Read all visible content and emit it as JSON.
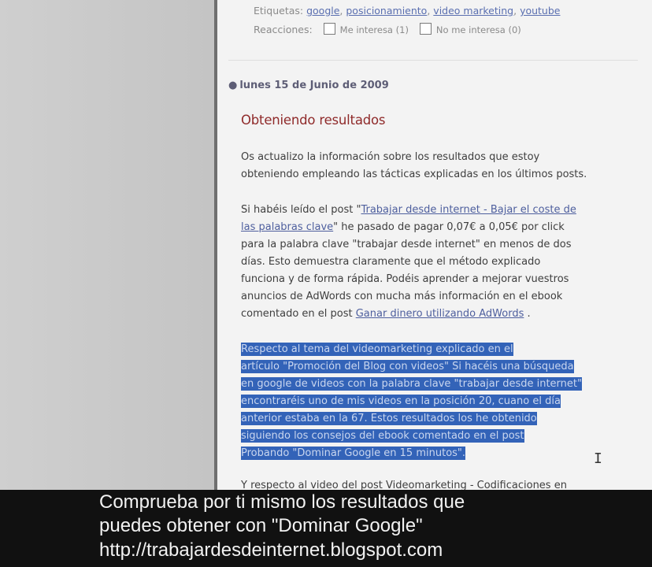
{
  "post_meta": {
    "tags_label": "Etiquetas:",
    "tags": [
      "google",
      "posicionamiento",
      "video marketing",
      "youtube"
    ],
    "reactions_label": "Reacciones:",
    "reactions": [
      {
        "label": "Me interesa (1)"
      },
      {
        "label": "No me interesa (0)"
      }
    ]
  },
  "post": {
    "date": "lunes 15 de Junio de 2009",
    "title": "Obteniendo resultados",
    "p1_lines": [
      "Os actualizo la información sobre los resultados que estoy",
      "obteniendo empleando las tácticas explicadas en los últimos posts."
    ],
    "p2": {
      "l1_pre": "Si habéis leído el post \"",
      "l1_link": "Trabajar desde internet - Bajar el coste de",
      "l2_link": "las palabras clave",
      "l2_post": "\" he pasado de pagar 0,07€ a 0,05€ por click",
      "l3": "para la palabra clave \"trabajar desde internet\" en menos de dos",
      "l4": "días. Esto demuestra claramente que el método explicado",
      "l5": "funciona y de forma rápida. Podéis aprender a mejorar vuestros",
      "l6": "anuncios de AdWords con mucha más información en el ebook",
      "l7_pre": "comentado en el post ",
      "l7_link": "Ganar dinero utilizando AdWords",
      "l7_post": " ."
    },
    "p3_lines": [
      "Respecto al tema del videomarketing explicado en el",
      "artículo \"Promoción del Blog con videos\" Si hacéis una búsqueda",
      "en google de videos con la palabra clave \"trabajar desde internet\"",
      "encontraréis uno de mis videos en la posición 20, cuano el día",
      "anterior estaba en la 67. Estos resultados los he obtenido",
      "siguiendo los consejos del ebook comentado en el post",
      "Probando \"Dominar Google en 15 minutos\"."
    ],
    "p4_partial": "Y respecto al video del post Videomarketing - Codificaciones en"
  },
  "caption": {
    "line1": "Comprueba por ti mismo los resultados que",
    "line2": "puedes obtener con \"Dominar Google\"",
    "line3": "http://trabajardesdeinternet.blogspot.com"
  }
}
